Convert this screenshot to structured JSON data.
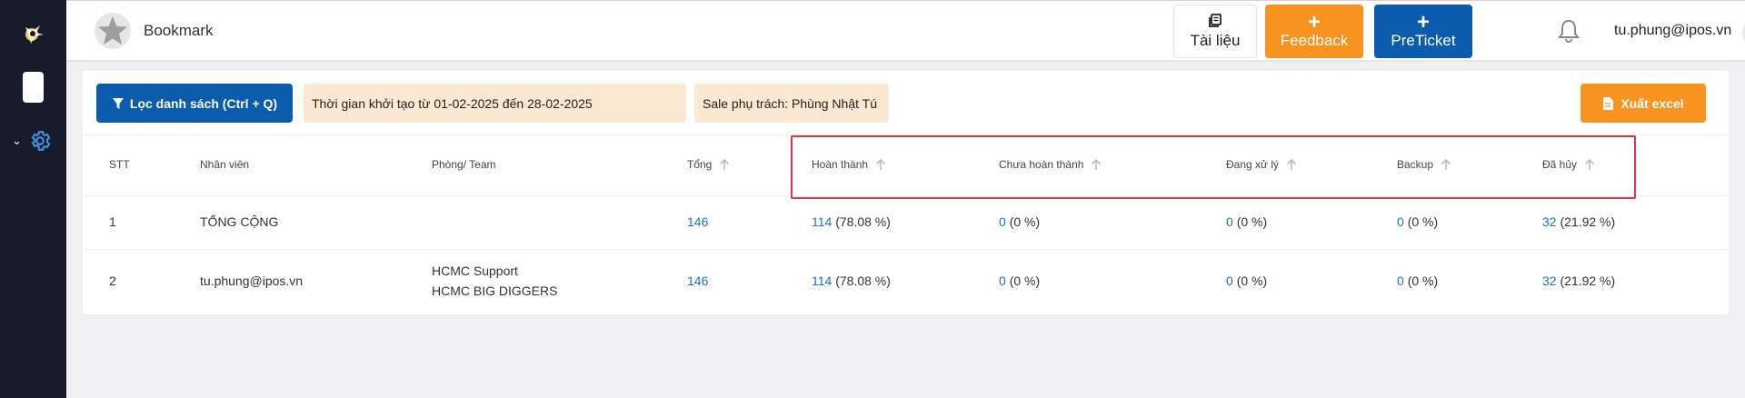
{
  "header": {
    "title": "Bookmark",
    "docs_label": "Tài liệu",
    "feedback_label": "Feedback",
    "preticket_label": "PreTicket",
    "plus": "+",
    "user_email": "tu.phung@ipos.vn"
  },
  "toolbar": {
    "filter_label": "Lọc danh sách (Ctrl + Q)",
    "date_chip": "Thời gian khởi tạo từ 01-02-2025 đến 28-02-2025",
    "sale_chip": "Sale phụ trách: Phùng Nhật Tú",
    "excel_label": "Xuất excel"
  },
  "table": {
    "headers": {
      "stt": "STT",
      "staff": "Nhân viên",
      "team": "Phòng/ Team",
      "total": "Tổng",
      "done": "Hoàn thành",
      "not_done": "Chưa hoàn thành",
      "processing": "Đang xử lý",
      "backup": "Backup",
      "cancelled": "Đã hủy"
    },
    "rows": [
      {
        "stt": "1",
        "staff": "TỔNG CỘNG",
        "team_line1": "",
        "team_line2": "",
        "total": "146",
        "done": "114",
        "done_pct": "(78.08 %)",
        "not_done": "0",
        "not_done_pct": "(0 %)",
        "processing": "0",
        "processing_pct": "(0 %)",
        "backup": "0",
        "backup_pct": "(0 %)",
        "cancelled": "32",
        "cancelled_pct": "(21.92 %)"
      },
      {
        "stt": "2",
        "staff": "tu.phung@ipos.vn",
        "team_line1": "HCMC Support",
        "team_line2": "HCMC BIG DIGGERS",
        "total": "146",
        "done": "114",
        "done_pct": "(78.08 %)",
        "not_done": "0",
        "not_done_pct": "(0 %)",
        "processing": "0",
        "processing_pct": "(0 %)",
        "backup": "0",
        "backup_pct": "(0 %)",
        "cancelled": "32",
        "cancelled_pct": "(21.92 %)"
      }
    ]
  },
  "colors": {
    "sidebar": "#161b29",
    "primary": "#0b5cad",
    "accent": "#f7931e",
    "chip": "#fbe8d3",
    "link": "#1a73c8",
    "highlight": "#dc3545"
  },
  "icons": [
    "app-logo-icon",
    "settings-gear-icon",
    "chevron-down-icon",
    "star-icon",
    "book-icon",
    "bell-icon",
    "user-icon",
    "filter-icon",
    "file-icon",
    "sort-arrow-up-icon"
  ]
}
